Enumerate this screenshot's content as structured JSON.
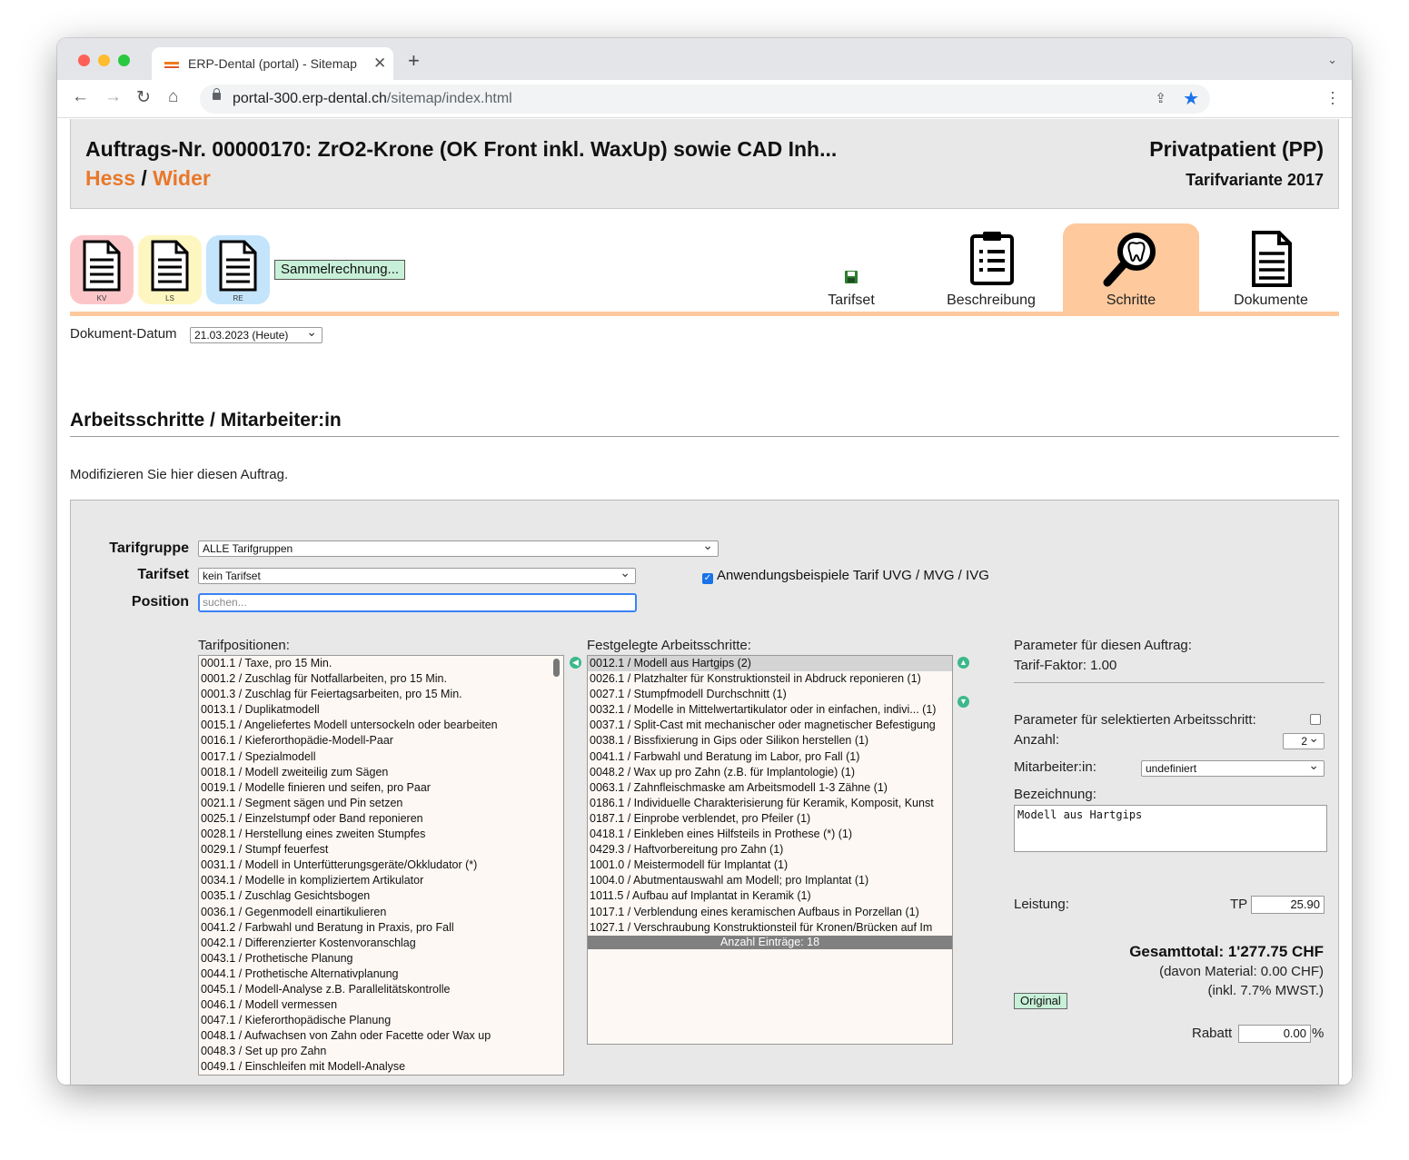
{
  "browser": {
    "tab_title": "ERP-Dental (portal) - Sitemap",
    "url_host": "portal-300.erp-dental.ch",
    "url_path": "/sitemap/index.html"
  },
  "header": {
    "title": "Auftrags-Nr. 00000170: ZrO2-Krone (OK Front inkl. WaxUp) sowie CAD Inh...",
    "name_first": "Hess",
    "name_sep": "/",
    "name_second": "Wider",
    "patient_type": "Privatpatient (PP)",
    "tariff_variant": "Tarifvariante 2017"
  },
  "doc_icons": [
    {
      "label": "KV",
      "color": "#fcc6c8"
    },
    {
      "label": "LS",
      "color": "#fdf6c0"
    },
    {
      "label": "RE",
      "color": "#c4e4fb"
    }
  ],
  "sammel_button": "Sammelrechnung...",
  "nav_tabs": [
    {
      "label": "Tarifset",
      "icon": "save-icon",
      "active": false
    },
    {
      "label": "Beschreibung",
      "icon": "clipboard-icon",
      "active": false
    },
    {
      "label": "Schritte",
      "icon": "tooth-magnifier-icon",
      "active": true
    },
    {
      "label": "Dokumente",
      "icon": "document-icon",
      "active": false
    }
  ],
  "document_date": {
    "label": "Dokument-Datum",
    "value": "21.03.2023 (Heute)"
  },
  "section": {
    "title": "Arbeitsschritte / Mitarbeiter:in",
    "intro": "Modifizieren Sie hier diesen Auftrag."
  },
  "form": {
    "tarifgruppe_label": "Tarifgruppe",
    "tarifgruppe_value": "ALLE Tarifgruppen",
    "tarifset_label": "Tarifset",
    "tarifset_value": "kein Tarifset",
    "position_label": "Position",
    "position_placeholder": "suchen...",
    "examples_checkbox": "Anwendungsbeispiele Tarif UVG / MVG / IVG"
  },
  "tarifpositionen": {
    "title": "Tarifpositionen:",
    "items": [
      "0001.1 / Taxe, pro 15 Min.",
      "0001.2 / Zuschlag für Notfallarbeiten, pro 15 Min.",
      "0001.3 / Zuschlag für Feiertagsarbeiten, pro 15 Min.",
      "0013.1 / Duplikatmodell",
      "0015.1 / Angeliefertes Modell untersockeln oder bearbeiten",
      "0016.1 / Kieferorthopädie-Modell-Paar",
      "0017.1 / Spezialmodell",
      "0018.1 / Modell zweiteilig zum Sägen",
      "0019.1 / Modelle finieren und seifen, pro Paar",
      "0021.1 / Segment sägen und Pin setzen",
      "0025.1 / Einzelstumpf oder Band reponieren",
      "0028.1 / Herstellung eines zweiten Stumpfes",
      "0029.1 / Stumpf feuerfest",
      "0031.1 / Modell in Unterfütterungsgeräte/Okkludator (*)",
      "0034.1 / Modelle in kompliziertem Artikulator",
      "0035.1 / Zuschlag Gesichtsbogen",
      "0036.1 / Gegenmodell einartikulieren",
      "0041.2 / Farbwahl und Beratung in Praxis, pro Fall",
      "0042.1 / Differenzierter Kostenvoranschlag",
      "0043.1 / Prothetische Planung",
      "0044.1 / Prothetische Alternativplanung",
      "0045.1 / Modell-Analyse z.B. Parallelitätskontrolle",
      "0046.1 / Modell vermessen",
      "0047.1 / Kieferorthopädische Planung",
      "0048.1 / Aufwachsen von Zahn oder Facette oder Wax up",
      "0048.3 / Set up pro Zahn",
      "0049.1 / Einschleifen mit Modell-Analyse"
    ]
  },
  "arbeitsschritte": {
    "title": "Festgelegte Arbeitsschritte:",
    "items": [
      "0012.1 / Modell aus Hartgips (2)",
      "0026.1 / Platzhalter für Konstruktionsteil in Abdruck reponieren (1)",
      "0027.1 / Stumpfmodell Durchschnitt (1)",
      "0032.1 / Modelle in Mittelwertartikulator oder in einfachen, indivi... (1)",
      "0037.1 / Split-Cast mit mechanischer oder magnetischer Befestigung",
      "0038.1 / Bissfixierung in Gips oder Silikon herstellen (1)",
      "0041.1 / Farbwahl und Beratung im Labor, pro Fall (1)",
      "0048.2 / Wax up pro Zahn (z.B. für Implantologie) (1)",
      "0063.1 / Zahnfleischmaske am Arbeitsmodell 1-3 Zähne (1)",
      "0186.1 / Individuelle Charakterisierung für Keramik, Komposit, Kunst",
      "0187.1 / Einprobe verblendet, pro Pfeiler (1)",
      "0418.1 / Einkleben eines Hilfsteils in Prothese (*) (1)",
      "0429.3 / Haftvorbereitung pro Zahn (1)",
      "1001.0 / Meistermodell für Implantat (1)",
      "1004.0 / Abutmentauswahl am Modell; pro Implantat (1)",
      "1011.5 / Aufbau auf Implantat in Keramik (1)",
      "1017.1 / Verblendung eines keramischen Aufbaus in Porzellan (1)",
      "1027.1 / Verschraubung Konstruktionsteil für Kronen/Brücken auf Im"
    ],
    "count_label": "Anzahl Einträge: 18"
  },
  "params": {
    "order_title": "Parameter für diesen Auftrag:",
    "tarif_factor": "Tarif-Faktor: 1.00",
    "step_title": "Parameter für selektierten Arbeitsschritt:",
    "anzahl_label": "Anzahl:",
    "anzahl_value": "2",
    "mitarbeiter_label": "Mitarbeiter:in:",
    "mitarbeiter_value": "undefiniert",
    "bezeichnung_label": "Bezeichnung:",
    "bezeichnung_value": "Modell aus Hartgips",
    "leistung_label": "Leistung:",
    "tp_label": "TP",
    "tp_value": "25.90",
    "total": "Gesamttotal: 1'277.75 CHF",
    "material": "(davon Material: 0.00 CHF)",
    "mwst": "(inkl. 7.7% MWST.)",
    "original_button": "Original",
    "rabatt_label": "Rabatt",
    "rabatt_value": "0.00",
    "percent": "%"
  },
  "colors": {
    "accent": "#fdc99d",
    "name_orange": "#e8782a",
    "green_button": "#c8f0d8"
  }
}
